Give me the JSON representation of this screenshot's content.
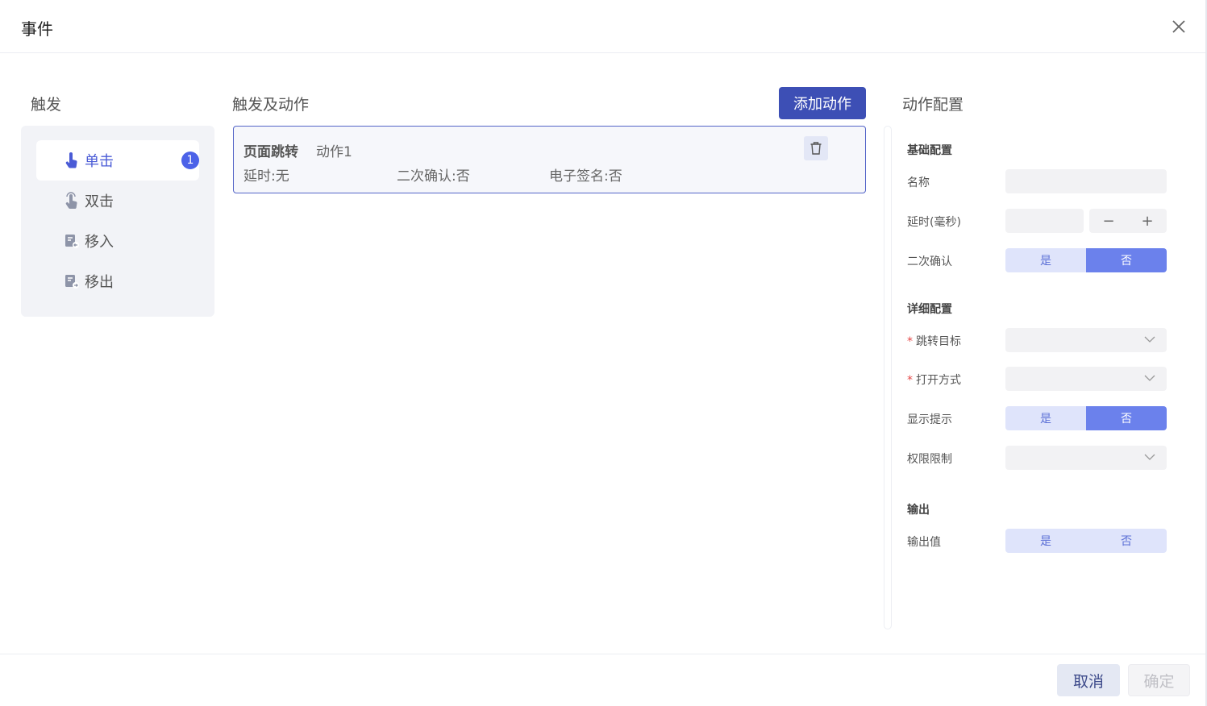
{
  "dialog": {
    "title": "事件"
  },
  "triggers": {
    "title": "触发",
    "items": [
      {
        "label": "单击",
        "icon": "tap-icon",
        "badge": "1",
        "active": true
      },
      {
        "label": "双击",
        "icon": "double-tap-icon"
      },
      {
        "label": "移入",
        "icon": "move-in-icon"
      },
      {
        "label": "移出",
        "icon": "move-out-icon"
      }
    ]
  },
  "actions": {
    "title": "触发及动作",
    "add_label": "添加动作",
    "items": [
      {
        "type": "页面跳转",
        "name": "动作1",
        "delay": "延时:无",
        "confirm": "二次确认:否",
        "signature": "电子签名:否"
      }
    ]
  },
  "config": {
    "title": "动作配置",
    "basic": {
      "title": "基础配置",
      "name_label": "名称",
      "delay_label": "延时(毫秒)",
      "minus": "−",
      "plus": "+",
      "confirm_label": "二次确认",
      "yes": "是",
      "no": "否"
    },
    "detail": {
      "title": "详细配置",
      "target_label": "跳转目标",
      "open_label": "打开方式",
      "hint_label": "显示提示",
      "permission_label": "权限限制"
    },
    "output": {
      "title": "输出",
      "value_label": "输出值"
    }
  },
  "footer": {
    "cancel": "取消",
    "confirm": "确定"
  },
  "colors": {
    "accent": "#3d4fb5",
    "badge": "#4c62e8",
    "segment_on": "#6b81ec",
    "required": "#e54848"
  }
}
